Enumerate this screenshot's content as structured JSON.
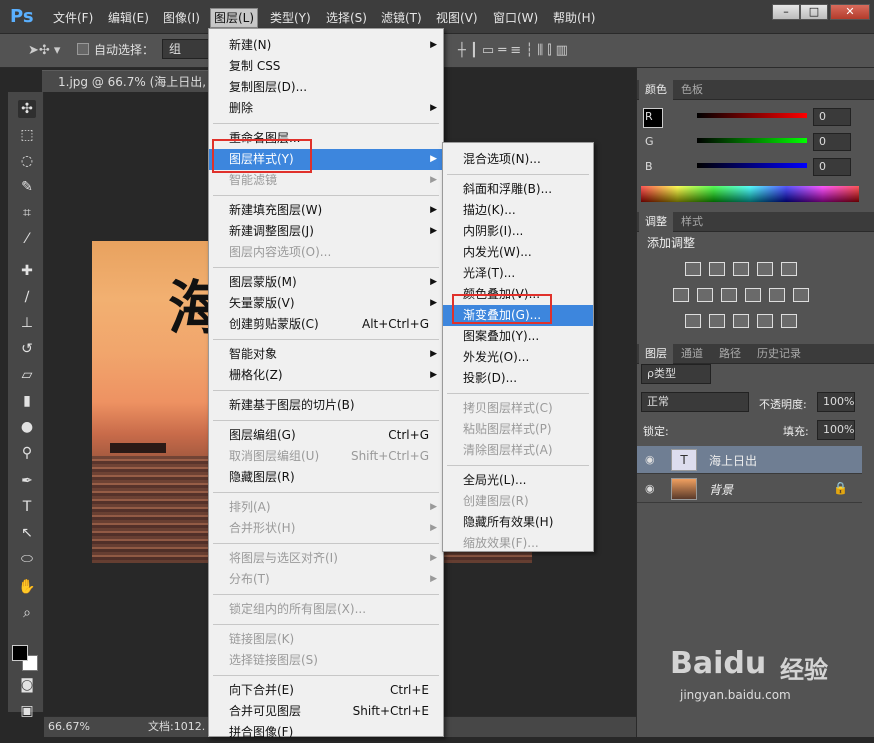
{
  "app": {
    "logo": "Ps"
  },
  "menubar": {
    "items": [
      "文件(F)",
      "编辑(E)",
      "图像(I)",
      "图层(L)",
      "类型(Y)",
      "选择(S)",
      "滤镜(T)",
      "视图(V)",
      "窗口(W)",
      "帮助(H)"
    ],
    "active_index": 3,
    "window_buttons": [
      "–",
      "□",
      "✕"
    ]
  },
  "options": {
    "auto_select_label": "自动选择：",
    "group_value": "组"
  },
  "document": {
    "tab_label": "1.jpg @ 66.7% (海上日出, R",
    "canvas_text": "海"
  },
  "status": {
    "zoom": "66.67%",
    "doc_info": "文档:1012."
  },
  "color_panel": {
    "tabs": [
      "颜色",
      "色板"
    ],
    "channels": [
      {
        "label": "R",
        "value": "0",
        "color": "#ff0000"
      },
      {
        "label": "G",
        "value": "0",
        "color": "#00ff00"
      },
      {
        "label": "B",
        "value": "0",
        "color": "#0000ff"
      }
    ]
  },
  "adjust_panel": {
    "tabs": [
      "调整",
      "样式"
    ],
    "title": "添加调整"
  },
  "layers_panel": {
    "tabs": [
      "图层",
      "通道",
      "路径",
      "历史记录"
    ],
    "filter_label": "ρ类型",
    "blend_mode": "正常",
    "opacity_label": "不透明度:",
    "opacity_value": "100%",
    "lock_label": "锁定:",
    "fill_label": "填充:",
    "fill_value": "100%",
    "layers": [
      {
        "name": "海上日出",
        "thumb": "T",
        "selected": true
      },
      {
        "name": "背景",
        "thumb": "",
        "selected": false
      }
    ]
  },
  "layer_menu": {
    "items": [
      {
        "label": "新建(N)",
        "arrow": true
      },
      {
        "label": "复制 CSS"
      },
      {
        "label": "复制图层(D)..."
      },
      {
        "label": "删除",
        "arrow": true
      },
      {
        "sep": true
      },
      {
        "label": "重命名图层..."
      },
      {
        "label": "图层样式(Y)",
        "arrow": true,
        "highlight": true
      },
      {
        "label": "智能滤镜",
        "disabled": true,
        "arrow": true
      },
      {
        "sep": true
      },
      {
        "label": "新建填充图层(W)",
        "arrow": true
      },
      {
        "label": "新建调整图层(J)",
        "arrow": true
      },
      {
        "label": "图层内容选项(O)...",
        "disabled": true
      },
      {
        "sep": true
      },
      {
        "label": "图层蒙版(M)",
        "arrow": true
      },
      {
        "label": "矢量蒙版(V)",
        "arrow": true
      },
      {
        "label": "创建剪贴蒙版(C)",
        "shortcut": "Alt+Ctrl+G"
      },
      {
        "sep": true
      },
      {
        "label": "智能对象",
        "arrow": true
      },
      {
        "label": "栅格化(Z)",
        "arrow": true
      },
      {
        "sep": true
      },
      {
        "label": "新建基于图层的切片(B)"
      },
      {
        "sep": true
      },
      {
        "label": "图层编组(G)",
        "shortcut": "Ctrl+G"
      },
      {
        "label": "取消图层编组(U)",
        "shortcut": "Shift+Ctrl+G",
        "disabled": true
      },
      {
        "label": "隐藏图层(R)"
      },
      {
        "sep": true
      },
      {
        "label": "排列(A)",
        "arrow": true,
        "disabled": true
      },
      {
        "label": "合并形状(H)",
        "arrow": true,
        "disabled": true
      },
      {
        "sep": true
      },
      {
        "label": "将图层与选区对齐(I)",
        "arrow": true,
        "disabled": true
      },
      {
        "label": "分布(T)",
        "arrow": true,
        "disabled": true
      },
      {
        "sep": true
      },
      {
        "label": "锁定组内的所有图层(X)...",
        "disabled": true
      },
      {
        "sep": true
      },
      {
        "label": "链接图层(K)",
        "disabled": true
      },
      {
        "label": "选择链接图层(S)",
        "disabled": true
      },
      {
        "sep": true
      },
      {
        "label": "向下合并(E)",
        "shortcut": "Ctrl+E"
      },
      {
        "label": "合并可见图层",
        "shortcut": "Shift+Ctrl+E"
      },
      {
        "label": "拼合图像(F)"
      }
    ]
  },
  "style_submenu": {
    "items": [
      {
        "label": "混合选项(N)..."
      },
      {
        "sep": true
      },
      {
        "label": "斜面和浮雕(B)..."
      },
      {
        "label": "描边(K)..."
      },
      {
        "label": "内阴影(I)..."
      },
      {
        "label": "内发光(W)..."
      },
      {
        "label": "光泽(T)..."
      },
      {
        "label": "颜色叠加(V)..."
      },
      {
        "label": "渐变叠加(G)...",
        "highlight": true
      },
      {
        "label": "图案叠加(Y)..."
      },
      {
        "label": "外发光(O)..."
      },
      {
        "label": "投影(D)..."
      },
      {
        "sep": true
      },
      {
        "label": "拷贝图层样式(C)",
        "disabled": true
      },
      {
        "label": "粘贴图层样式(P)",
        "disabled": true
      },
      {
        "label": "清除图层样式(A)",
        "disabled": true
      },
      {
        "sep": true
      },
      {
        "label": "全局光(L)..."
      },
      {
        "label": "创建图层(R)",
        "disabled": true
      },
      {
        "label": "隐藏所有效果(H)"
      },
      {
        "label": "缩放效果(F)...",
        "disabled": true
      }
    ]
  },
  "watermark": {
    "brand": "Baidu",
    "brand_cn": "经验",
    "url": "jingyan.baidu.com"
  }
}
